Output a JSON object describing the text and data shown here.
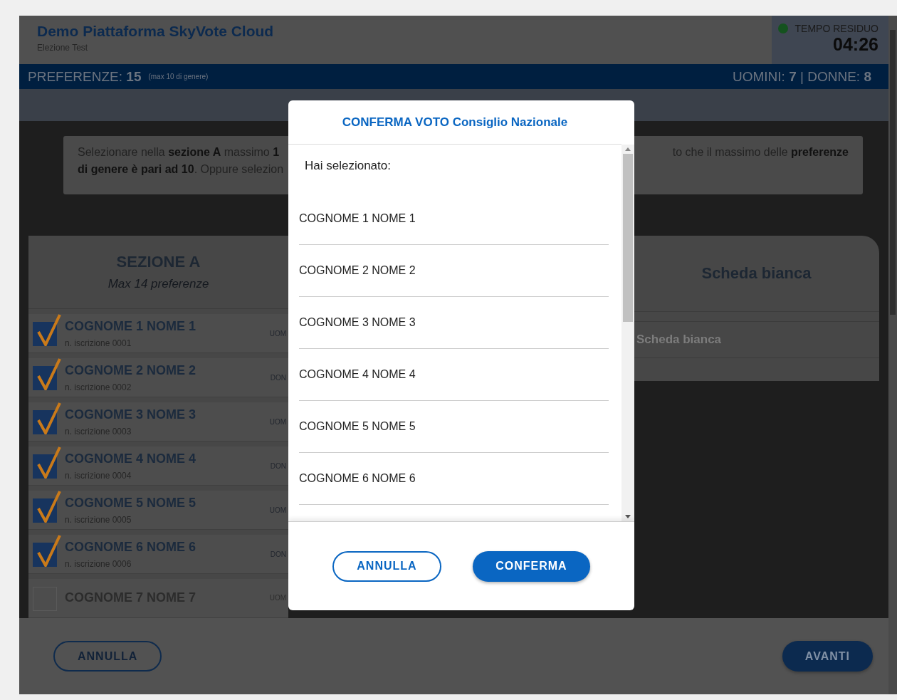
{
  "header": {
    "title": "Demo Piattaforma SkyVote Cloud",
    "subtitle": "Elezione Test",
    "timer_label": "TEMPO RESIDUO",
    "timer_value": "04:26"
  },
  "summary_bar": {
    "preferences": "PREFERENZE: **15**",
    "note": "(max 10 di genere)",
    "gender_counts": "UOMINI: **7** | DONNE: **8**"
  },
  "instructions": {
    "left_lines": [
      "Selezionare nella **sezione A** massimo **1**",
      "**di genere è pari ad 10**. Oppure selezion"
    ],
    "right_lines": [
      "to che il massimo delle **preferenze**"
    ]
  },
  "section_a": {
    "title": "SEZIONE A",
    "subtitle": "Max 14 preferenze",
    "candidates": [
      {
        "name": "COGNOME 1 NOME 1",
        "registration": "n. iscrizione 0001",
        "gender_tag": "UOM",
        "checked": true
      },
      {
        "name": "COGNOME 2 NOME 2",
        "registration": "n. iscrizione 0002",
        "gender_tag": "DON",
        "checked": true
      },
      {
        "name": "COGNOME 3 NOME 3",
        "registration": "n. iscrizione 0003",
        "gender_tag": "UOM",
        "checked": true
      },
      {
        "name": "COGNOME 4 NOME 4",
        "registration": "n. iscrizione 0004",
        "gender_tag": "DON",
        "checked": true
      },
      {
        "name": "COGNOME 5 NOME 5",
        "registration": "n. iscrizione 0005",
        "gender_tag": "UOM",
        "checked": true
      },
      {
        "name": "COGNOME 6 NOME 6",
        "registration": "n. iscrizione 0006",
        "gender_tag": "DON",
        "checked": true
      },
      {
        "name": "COGNOME 7 NOME 7",
        "gender_tag": "UOM",
        "checked": false
      }
    ]
  },
  "blank_ballot": {
    "title": "Scheda bianca",
    "option": "Scheda bianca"
  },
  "footer": {
    "cancel": "ANNULLA",
    "next": "AVANTI"
  },
  "modal": {
    "title": "CONFERMA VOTO Consiglio Nazionale",
    "intro": "Hai selezionato:",
    "items": [
      "COGNOME 1 NOME 1",
      "COGNOME 2 NOME 2",
      "COGNOME 3 NOME 3",
      "COGNOME 4 NOME 4",
      "COGNOME 5 NOME 5",
      "COGNOME 6 NOME 6"
    ],
    "cancel": "ANNULLA",
    "confirm": "CONFERMA"
  }
}
